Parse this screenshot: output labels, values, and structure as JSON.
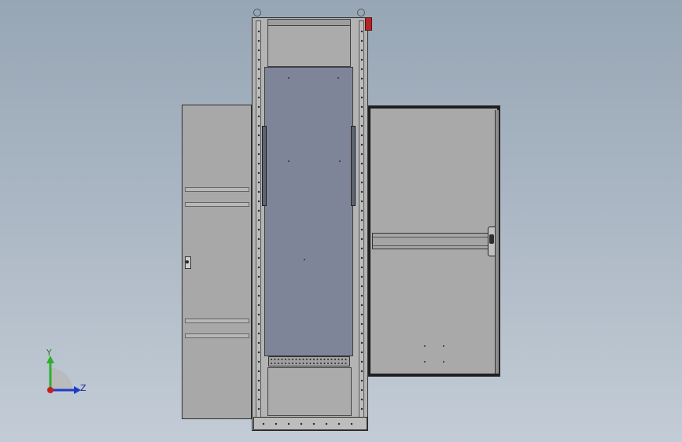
{
  "viewport": {
    "background_top": "#97a6b5",
    "background_bottom": "#c3ccd6"
  },
  "model": {
    "frame_color": "#b4b4b4",
    "back_plate_color": "#7e8598",
    "door_color": "#a9a9a9",
    "edge_color": "#2e2e2e",
    "handle_accent": "#b3262a"
  },
  "triad": {
    "y_label": "Y",
    "z_label": "Z",
    "y_color": "#2fae2f",
    "z_color": "#1e3cc8",
    "origin_color": "#c81e1e"
  }
}
